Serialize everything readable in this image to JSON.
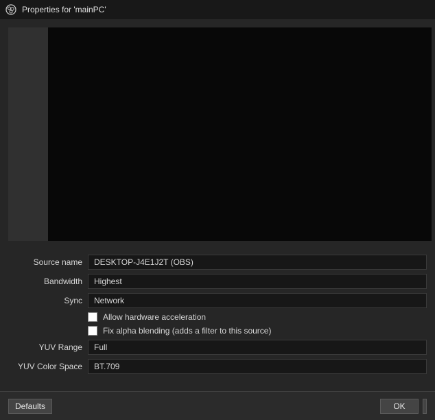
{
  "window": {
    "title": "Properties for 'mainPC'"
  },
  "form": {
    "source_name": {
      "label": "Source name",
      "value": "DESKTOP-J4E1J2T (OBS)"
    },
    "bandwidth": {
      "label": "Bandwidth",
      "value": "Highest"
    },
    "sync": {
      "label": "Sync",
      "value": "Network"
    },
    "hw_accel": {
      "label": "Allow hardware acceleration",
      "checked": false
    },
    "fix_alpha": {
      "label": "Fix alpha blending (adds a filter to this source)",
      "checked": false
    },
    "yuv_range": {
      "label": "YUV Range",
      "value": "Full"
    },
    "yuv_color_space": {
      "label": "YUV Color Space",
      "value": "BT.709"
    }
  },
  "buttons": {
    "defaults": "Defaults",
    "ok": "OK"
  }
}
